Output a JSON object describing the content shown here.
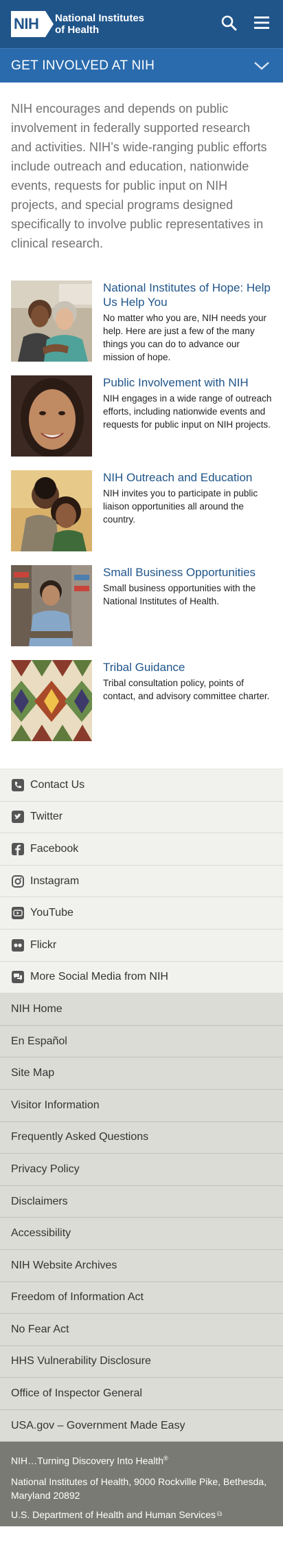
{
  "header": {
    "logo_abbr": "NIH",
    "logo_line1": "National Institutes",
    "logo_line2": "of Health",
    "search_icon": "search-icon",
    "menu_icon": "hamburger-menu-icon"
  },
  "section": {
    "title": "GET INVOLVED AT NIH",
    "toggle_icon": "chevron-down-icon"
  },
  "intro": "NIH encourages and depends on public involvement in federally supported research and activities. NIH’s wide-ranging public efforts include outreach and education, nationwide events, requests for public input on NIH projects, and special programs designed specifically to involve public representatives in clinical research.",
  "features": [
    {
      "title": "National Institutes of Hope: Help Us Help You",
      "desc": "No matter who you are, NIH needs your help. Here are just a few of the many things you can do to advance our mission of hope."
    },
    {
      "title": "Public Involvement with NIH",
      "desc": "NIH engages in a wide range of outreach efforts, including nationwide events and requests for public input on NIH projects."
    },
    {
      "title": "NIH Outreach and Education",
      "desc": "NIH invites you to participate in public liaison opportunities all around the country."
    },
    {
      "title": "Small Business Opportunities",
      "desc": "Small business opportunities with the National Institutes of Health."
    },
    {
      "title": "Tribal Guidance",
      "desc": "Tribal consultation policy, points of contact, and advisory committee charter."
    }
  ],
  "social": [
    {
      "label": "Contact Us",
      "icon": "phone-icon"
    },
    {
      "label": "Twitter",
      "icon": "twitter-icon"
    },
    {
      "label": "Facebook",
      "icon": "facebook-icon"
    },
    {
      "label": "Instagram",
      "icon": "instagram-icon"
    },
    {
      "label": "YouTube",
      "icon": "youtube-icon"
    },
    {
      "label": "Flickr",
      "icon": "flickr-icon"
    },
    {
      "label": "More Social Media from NIH",
      "icon": "chat-bubbles-icon"
    }
  ],
  "links": [
    "NIH Home",
    "En Español",
    "Site Map",
    "Visitor Information",
    "Frequently Asked Questions",
    "Privacy Policy",
    "Disclaimers",
    "Accessibility",
    "NIH Website Archives",
    "Freedom of Information Act",
    "No Fear Act",
    "HHS Vulnerability Disclosure",
    "Office of Inspector General",
    "USA.gov – Government Made Easy"
  ],
  "footer": {
    "tagline": "NIH…Turning Discovery Into Health",
    "trademark": "®",
    "address": "National Institutes of Health, 9000 Rockville Pike, Bethesda, Maryland 20892",
    "hhs": "U.S. Department of Health and Human Services"
  },
  "colors": {
    "header_bg": "#20558a",
    "section_bg": "#2a6bad",
    "link_blue": "#20558a",
    "social_bg": "#f1f1ee",
    "links_bg": "#dcdcd6",
    "footer_bg": "#7a7a74"
  }
}
